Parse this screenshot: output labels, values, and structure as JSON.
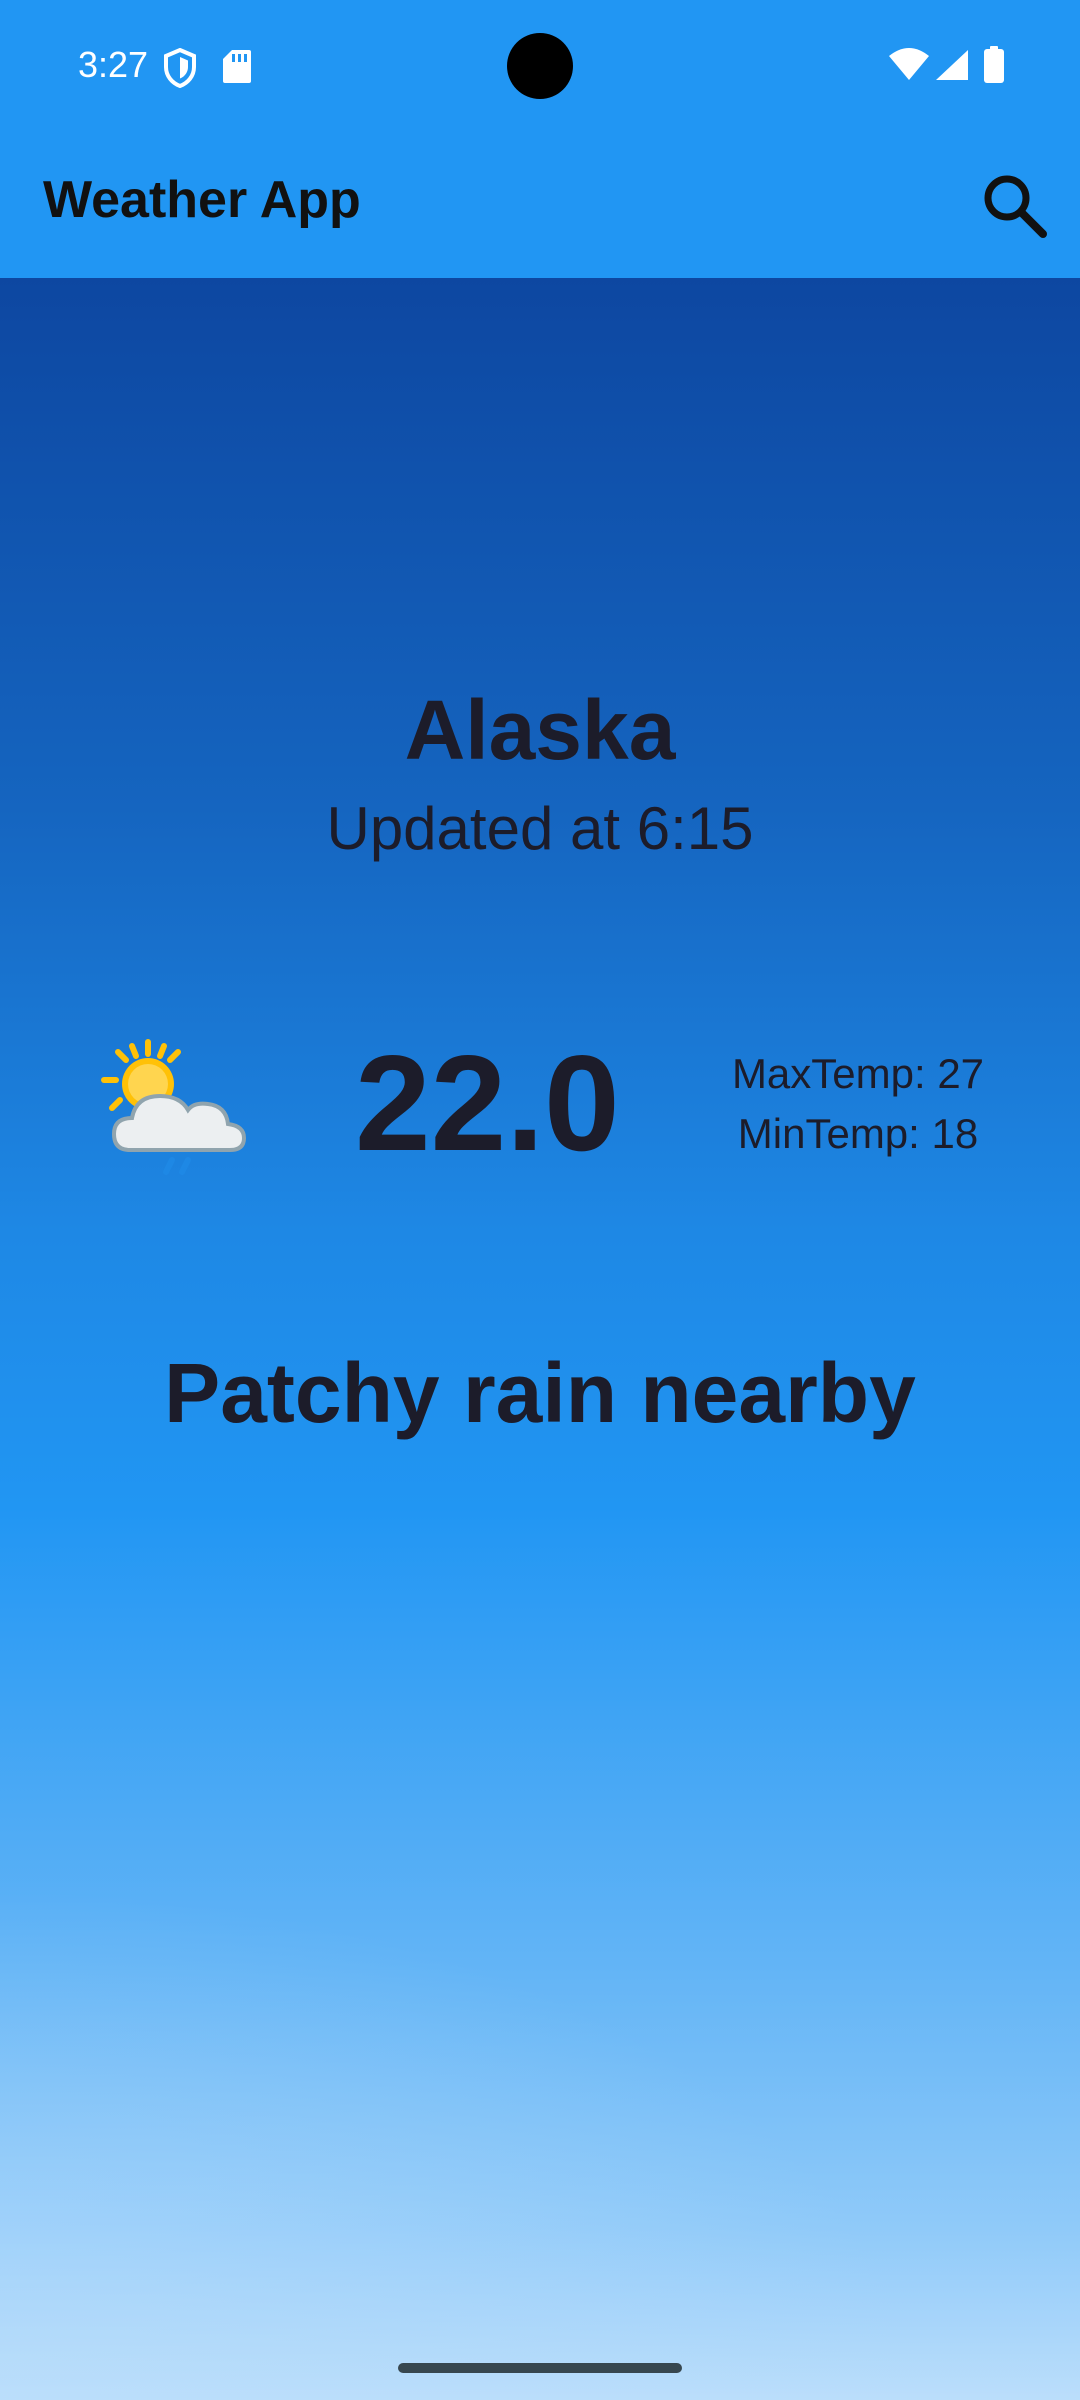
{
  "status_bar": {
    "time": "3:27",
    "icons": [
      "shield-icon",
      "sd-card-icon",
      "wifi-icon",
      "signal-icon",
      "battery-icon"
    ]
  },
  "app_bar": {
    "title": "Weather App",
    "search_icon": "search-icon"
  },
  "weather": {
    "city": "Alaska",
    "updated": "Updated at 6:15",
    "temperature": "22.0",
    "max_temp": "MaxTemp: 27",
    "min_temp": "MinTemp: 18",
    "condition": "Patchy rain nearby",
    "condition_icon": "partly-cloudy-rain-icon"
  },
  "colors": {
    "app_bar": "#2196F3",
    "gradient_top": "#0D47A1",
    "gradient_bottom": "#BBDEFB",
    "text_dark": "#1c1c2a"
  }
}
